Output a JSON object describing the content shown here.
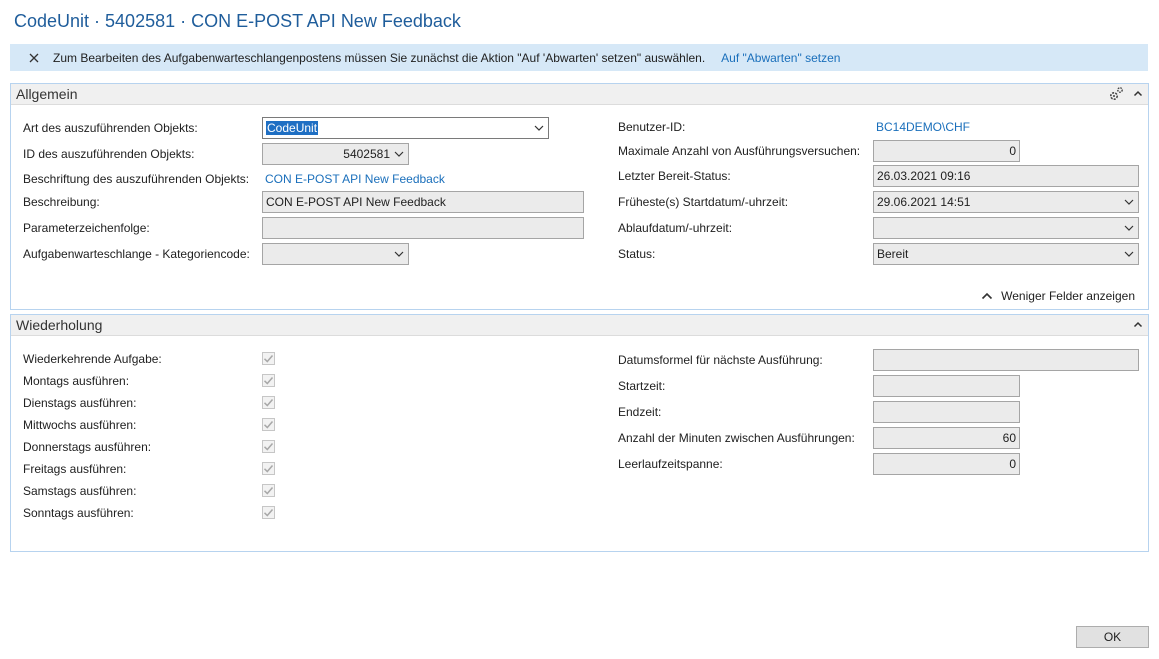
{
  "window": {
    "title": "CodeUnit · 5402581 · CON E-POST API New Feedback"
  },
  "notification": {
    "message": "Zum Bearbeiten des Aufgabenwarteschlangenpostens müssen Sie zunächst die Aktion \"Auf 'Abwarten' setzen\" auswählen.",
    "action": "Auf \"Abwarten\" setzen"
  },
  "general": {
    "caption": "Allgemein",
    "object_type": {
      "label": "Art des auszuführenden Objekts:",
      "value": "CodeUnit"
    },
    "object_id": {
      "label": "ID des auszuführenden Objekts:",
      "value": "5402581"
    },
    "object_caption": {
      "label": "Beschriftung des auszuführenden Objekts:",
      "value": "CON E-POST API New Feedback"
    },
    "description": {
      "label": "Beschreibung:",
      "value": "CON E-POST API New Feedback"
    },
    "parameter_string": {
      "label": "Parameterzeichenfolge:",
      "value": ""
    },
    "category_code": {
      "label": "Aufgabenwarteschlange - Kategoriencode:",
      "value": ""
    },
    "user_id": {
      "label": "Benutzer-ID:",
      "value": "BC14DEMO\\CHF"
    },
    "max_attempts": {
      "label": "Maximale Anzahl von Ausführungsversuchen:",
      "value": "0"
    },
    "last_ready_state": {
      "label": "Letzter Bereit-Status:",
      "value": "26.03.2021 09:16"
    },
    "earliest_start": {
      "label": "Früheste(s) Startdatum/-uhrzeit:",
      "value": "29.06.2021 14:51"
    },
    "expiration": {
      "label": "Ablaufdatum/-uhrzeit:",
      "value": ""
    },
    "status": {
      "label": "Status:",
      "value": "Bereit"
    },
    "fewer_fields": "Weniger Felder anzeigen"
  },
  "recurrence": {
    "caption": "Wiederholung",
    "checkboxes": [
      {
        "label": "Wiederkehrende Aufgabe:",
        "checked": true
      },
      {
        "label": "Montags ausführen:",
        "checked": true
      },
      {
        "label": "Dienstags ausführen:",
        "checked": true
      },
      {
        "label": "Mittwochs ausführen:",
        "checked": true
      },
      {
        "label": "Donnerstags ausführen:",
        "checked": true
      },
      {
        "label": "Freitags ausführen:",
        "checked": true
      },
      {
        "label": "Samstags ausführen:",
        "checked": true
      },
      {
        "label": "Sonntags ausführen:",
        "checked": true
      }
    ],
    "date_formula": {
      "label": "Datumsformel für nächste Ausführung:",
      "value": ""
    },
    "start_time": {
      "label": "Startzeit:",
      "value": ""
    },
    "end_time": {
      "label": "Endzeit:",
      "value": ""
    },
    "minutes_between": {
      "label": "Anzahl der Minuten zwischen Ausführungen:",
      "value": "60"
    },
    "inactivity": {
      "label": "Leerlaufzeitspanne:",
      "value": "0"
    }
  },
  "buttons": {
    "ok": "OK"
  },
  "colors": {
    "title": "#1f5d9b",
    "link": "#1a6fbb",
    "banner": "#d6e8f7",
    "selection": "#1f6fc3"
  }
}
